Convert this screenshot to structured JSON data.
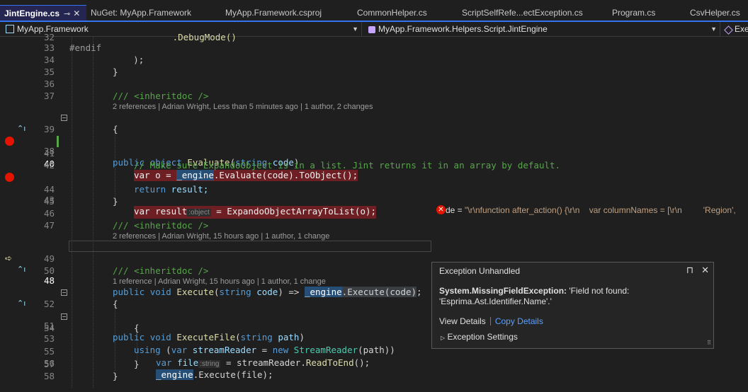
{
  "tabs": [
    {
      "label": "JintEngine.cs",
      "active": true
    },
    {
      "label": "NuGet: MyApp.Framework"
    },
    {
      "label": "MyApp.Framework.csproj"
    },
    {
      "label": "CommonHelper.cs"
    },
    {
      "label": "ScriptSelfRefe...ectException.cs"
    },
    {
      "label": "Program.cs"
    },
    {
      "label": "CsvHelper.cs"
    }
  ],
  "tab_icons": {
    "pin": "⊸",
    "close": "✕"
  },
  "navbar": {
    "project": "MyApp.Framework",
    "type": "MyApp.Framework.Helpers.Script.JintEngine",
    "member": "Exe"
  },
  "code": {
    "l32": {
      "num": "32",
      "t1": "   .DebugMode()"
    },
    "l33": {
      "num": "33",
      "t1": "#endif"
    },
    "l34": {
      "num": "34",
      "t1": "        );"
    },
    "l35": {
      "num": "35",
      "t1": "}"
    },
    "l36": {
      "num": "36"
    },
    "l37": {
      "num": "37",
      "t1": "/// <inheritdoc />"
    },
    "lens38": "2 references | Adrian Wright, Less than 5 minutes ago | 1 author, 2 changes",
    "l38": {
      "num": "38",
      "k1": "public",
      "k2": "object",
      "f": "Evaluate",
      "p": "(",
      "k3": "string",
      "v": "code",
      "e": ")"
    },
    "l39": {
      "num": "39",
      "t1": "{"
    },
    "l40": {
      "num": "40",
      "k1": "var",
      "t1": " o = ",
      "hl": "_engine",
      "t2": ".Evaluate(code).ToObject();"
    },
    "l41": {
      "num": "41"
    },
    "l42": {
      "num": "42",
      "cm": "// Make sure ExpandoObject is in a list. Jint returns it in an array by default."
    },
    "l43": {
      "num": "43",
      "k1": "var",
      "t1": " result",
      "hint": ":object",
      "t2": " = ExpandoObjectArrayToList(o);"
    },
    "l44": {
      "num": "44",
      "k1": "return",
      "t1": " result;"
    },
    "l45": {
      "num": "45",
      "t1": "}"
    },
    "l46": {
      "num": "46"
    },
    "l47": {
      "num": "47",
      "t1": "/// <inheritdoc />"
    },
    "lens48": "2 references | Adrian Wright, 15 hours ago | 1 author, 1 change",
    "l48": {
      "num": "48",
      "k1": "public",
      "k2": "void",
      "f": "Execute",
      "p": "(",
      "k3": "string",
      "v": "code",
      "e": ") => ",
      "hl": "_engine",
      "hl2": ".Execute(code)",
      "t2": ";"
    },
    "l49": {
      "num": "49"
    },
    "l50": {
      "num": "50",
      "t1": "/// <inheritdoc />"
    },
    "lens51": "1 reference | Adrian Wright, 15 hours ago | 1 author, 1 change",
    "l51": {
      "num": "51",
      "k1": "public",
      "k2": "void",
      "f": "ExecuteFile",
      "p": "(",
      "k3": "string",
      "v": "path",
      "e": ")"
    },
    "l52": {
      "num": "52",
      "t1": "{"
    },
    "l53": {
      "num": "53",
      "k1": "using",
      "t1": " (",
      "k2": "var",
      "v": " streamReader",
      "t2": " = ",
      "k3": "new",
      "ty": " StreamReader",
      "t3": "(path))"
    },
    "l54": {
      "num": "54",
      "t1": "{"
    },
    "l55": {
      "num": "55",
      "k1": "var",
      "v": " file",
      "hint": ":string",
      "t1": " = streamReader.",
      "f": "ReadToEnd",
      "t2": "();"
    },
    "l56": {
      "num": "56",
      "hl": "_engine",
      "t1": ".Execute(file);"
    },
    "l57": {
      "num": "57",
      "t1": "}"
    },
    "l58": {
      "num": "58",
      "t1": "}"
    }
  },
  "inline_value": {
    "prefix": "de = ",
    "value": "\"\\r\\nfunction after_action() {\\r\\n    var columnNames = [\\r\\n         'Region',"
  },
  "exception": {
    "title": "Exception Unhandled",
    "type": "System.MissingFieldException:",
    "message": " 'Field not found: 'Esprima.Ast.Identifier.Name'.'",
    "view_details": "View Details",
    "copy_details": "Copy Details",
    "settings": "Exception Settings",
    "pin_icon": "⊓",
    "close_icon": "✕",
    "expand_icon": "▷",
    "grip_icon": "⠿"
  },
  "colors": {
    "keyword": "#569cd6",
    "type": "#4ec9b0",
    "method": "#dcdcaa",
    "comment": "#57a64a",
    "breakpoint": "#e51400",
    "accent": "#3574f0"
  }
}
